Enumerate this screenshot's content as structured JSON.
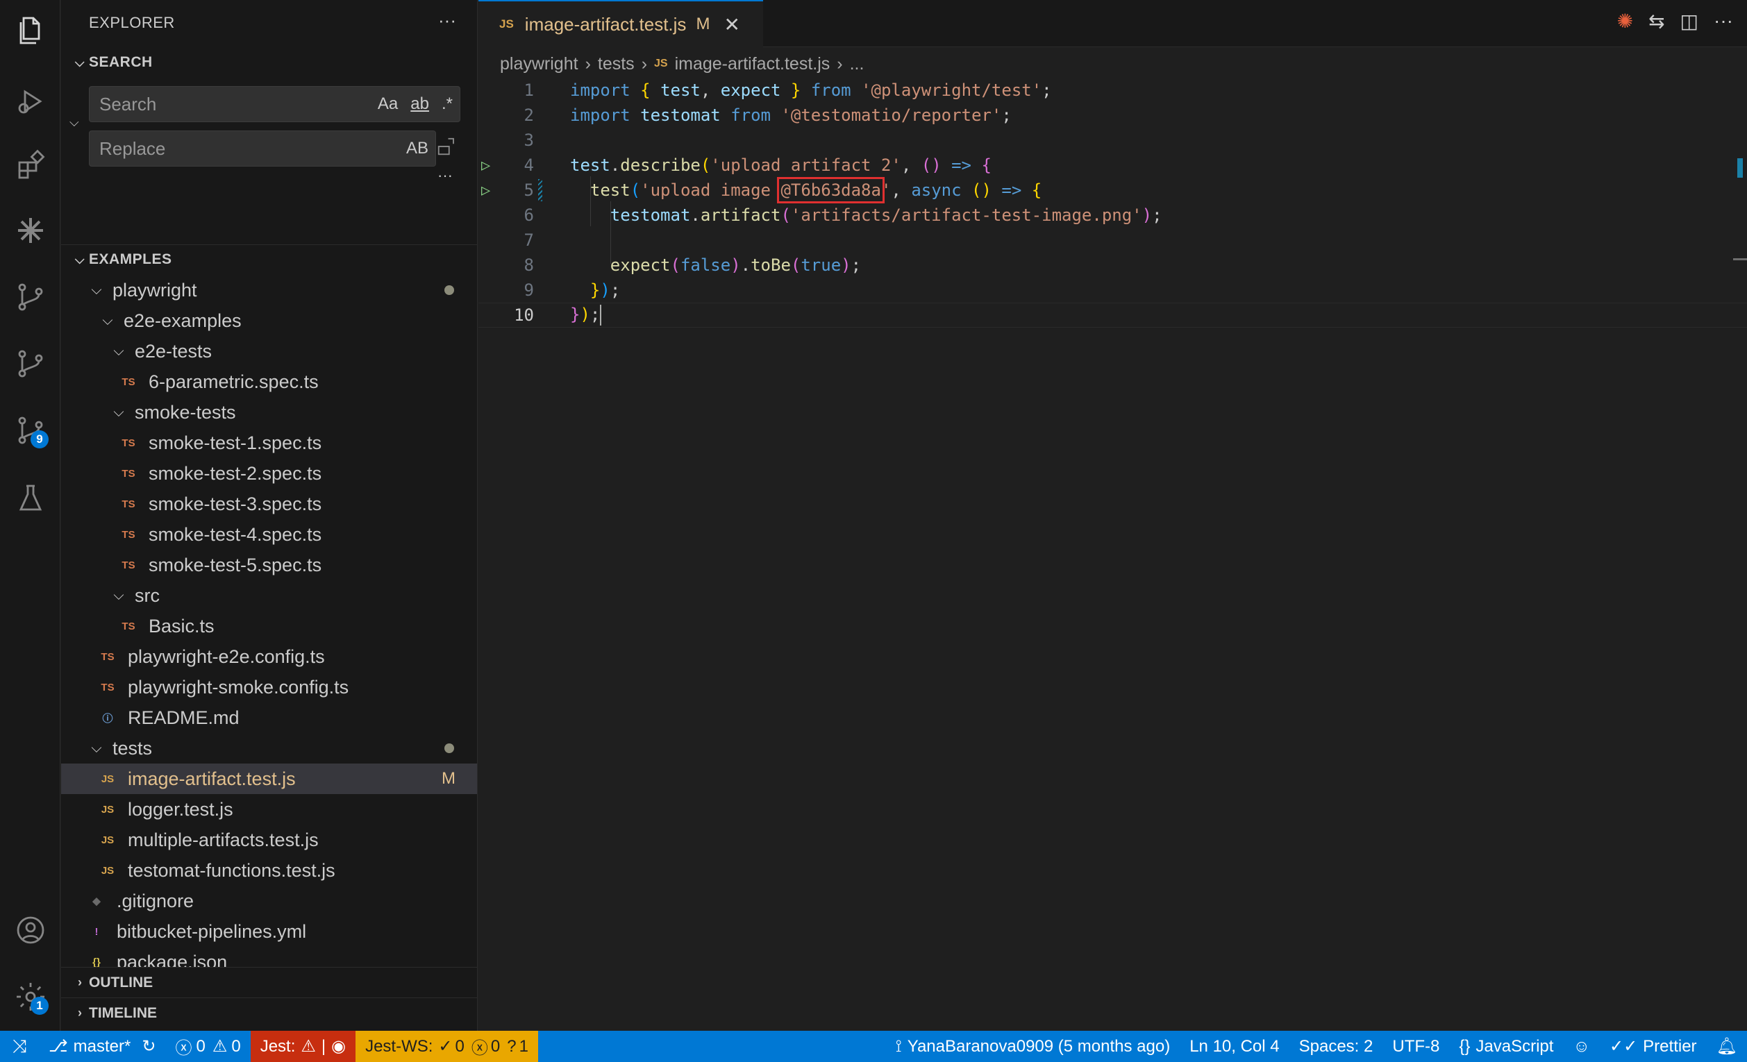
{
  "sidebar": {
    "title": "EXPLORER",
    "more": "···",
    "search_section": "SEARCH",
    "search": {
      "placeholder": "Search",
      "opt1": "Aa",
      "opt2": "ab",
      "opt3": ".*"
    },
    "replace": {
      "placeholder": "Replace",
      "opt": "AB"
    },
    "examples_section": "EXAMPLES",
    "tree": [
      {
        "label": "playwright",
        "kind": "folder",
        "git": "dot"
      },
      {
        "label": "e2e-examples",
        "kind": "folder"
      },
      {
        "label": "e2e-tests",
        "kind": "folder"
      },
      {
        "label": "6-parametric.spec.ts",
        "kind": "ts"
      },
      {
        "label": "smoke-tests",
        "kind": "folder"
      },
      {
        "label": "smoke-test-1.spec.ts",
        "kind": "ts"
      },
      {
        "label": "smoke-test-2.spec.ts",
        "kind": "ts"
      },
      {
        "label": "smoke-test-3.spec.ts",
        "kind": "ts"
      },
      {
        "label": "smoke-test-4.spec.ts",
        "kind": "ts"
      },
      {
        "label": "smoke-test-5.spec.ts",
        "kind": "ts"
      },
      {
        "label": "src",
        "kind": "folder"
      },
      {
        "label": "Basic.ts",
        "kind": "ts"
      },
      {
        "label": "playwright-e2e.config.ts",
        "kind": "ts"
      },
      {
        "label": "playwright-smoke.config.ts",
        "kind": "ts"
      },
      {
        "label": "README.md",
        "kind": "info"
      },
      {
        "label": "tests",
        "kind": "folder",
        "git": "dot"
      },
      {
        "label": "image-artifact.test.js",
        "kind": "js",
        "git": "M",
        "selected": true
      },
      {
        "label": "logger.test.js",
        "kind": "js"
      },
      {
        "label": "multiple-artifacts.test.js",
        "kind": "js"
      },
      {
        "label": "testomat-functions.test.js",
        "kind": "js"
      },
      {
        "label": ".gitignore",
        "kind": "git"
      },
      {
        "label": "bitbucket-pipelines.yml",
        "kind": "yml"
      },
      {
        "label": "package.json",
        "kind": "json"
      }
    ],
    "outline": "OUTLINE",
    "timeline": "TIMELINE"
  },
  "activity": {
    "items": [
      "explorer-icon",
      "run-debug-icon",
      "extensions-icon",
      "testomat-icon",
      "source-control-icon",
      "git-graph-icon",
      "source-control-2-icon",
      "testing-icon"
    ],
    "scm_badge": "9",
    "settings_badge": "1"
  },
  "editor": {
    "tab": {
      "icon": "JS",
      "label": "image-artifact.test.js",
      "status": "M",
      "close": "✕"
    },
    "breadcrumb": {
      "part1": "playwright",
      "part2": "tests",
      "icon": "JS",
      "file": "image-artifact.test.js",
      "more": "..."
    },
    "lines": [
      {
        "n": "1"
      },
      {
        "n": "2"
      },
      {
        "n": "3"
      },
      {
        "n": "4"
      },
      {
        "n": "5"
      },
      {
        "n": "6"
      },
      {
        "n": "7"
      },
      {
        "n": "8"
      },
      {
        "n": "9"
      },
      {
        "n": "10"
      }
    ],
    "code": {
      "l1_import": "import",
      "l1_test": "test",
      "l1_expect": "expect",
      "l1_from": "from",
      "l1_mod": "'@playwright/test'",
      "l2_import": "import",
      "l2_id": "testomat",
      "l2_from": "from",
      "l2_mod": "'@testomatio/reporter'",
      "l4_test": "test",
      "l4_fn": "describe",
      "l4_str": "'upload artifact 2'",
      "l5_fn": "test",
      "l5_str1": "'upload image ",
      "l5_tag": "@T6b63da8a",
      "l5_str2": "'",
      "l5_async": "async",
      "l6_obj": "testomat",
      "l6_fn": "artifact",
      "l6_str": "'artifacts/artifact-test-image.png'",
      "l8_fn": "expect",
      "l8_arg": "false",
      "l8_fn2": "toBe",
      "l8_arg2": "true"
    }
  },
  "statusbar": {
    "branch": "master*",
    "errors": "0",
    "warnings": "0",
    "jest": "Jest:",
    "jestws": "Jest-WS:",
    "jestws_pass": "0",
    "jestws_fail": "0",
    "jestws_unknown": "1",
    "blame": "YanaBaranova0909 (5 months ago)",
    "position": "Ln 10, Col 4",
    "spaces": "Spaces: 2",
    "encoding": "UTF-8",
    "language": "JavaScript",
    "prettier": "Prettier"
  },
  "colors": {
    "accent": "#0078d4",
    "jest_error": "#c72e0f",
    "jest_ws": "#e9a700",
    "tag_highlight": "#e03030"
  }
}
